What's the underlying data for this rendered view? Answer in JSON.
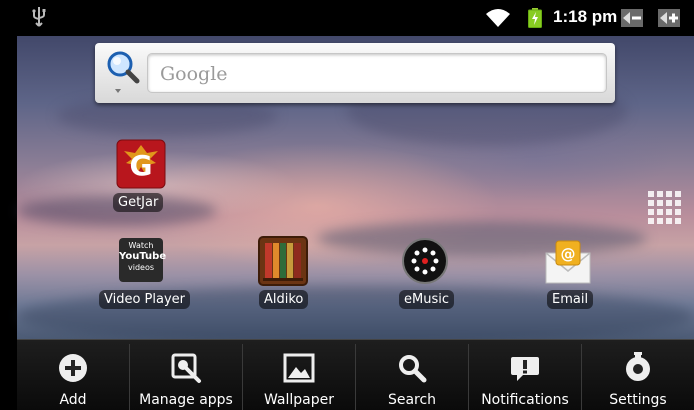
{
  "status_bar": {
    "time": "1:18 pm",
    "icons": [
      "usb-icon",
      "wifi-icon",
      "battery-charging-icon",
      "volume-down-icon",
      "volume-up-icon"
    ]
  },
  "search": {
    "placeholder": "Google"
  },
  "apps": [
    {
      "id": "getjar",
      "label": "GetJar"
    },
    {
      "id": "video-player",
      "label": "Video Player",
      "icon_text": [
        "Watch",
        "YouTube",
        "videos"
      ]
    },
    {
      "id": "aldiko",
      "label": "Aldiko"
    },
    {
      "id": "emusic",
      "label": "eMusic"
    },
    {
      "id": "email",
      "label": "Email"
    }
  ],
  "menu": {
    "items": [
      {
        "label": "Add",
        "icon": "add-icon"
      },
      {
        "label": "Manage apps",
        "icon": "manage-apps-icon"
      },
      {
        "label": "Wallpaper",
        "icon": "wallpaper-icon"
      },
      {
        "label": "Search",
        "icon": "search-icon"
      },
      {
        "label": "Notifications",
        "icon": "notifications-icon"
      },
      {
        "label": "Settings",
        "icon": "settings-icon"
      }
    ]
  },
  "colors": {
    "status_bar_bg": "#000000",
    "menu_bg": "#151515",
    "getjar_red": "#b8161d",
    "email_gold": "#f0b020"
  }
}
